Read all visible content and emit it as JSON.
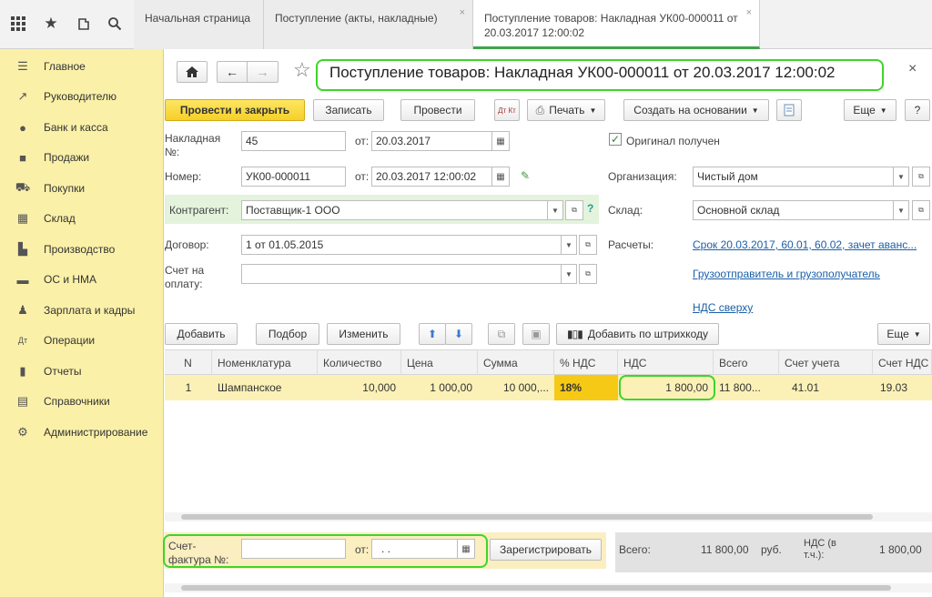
{
  "topbar": {
    "tabs": [
      {
        "label": "Начальная страница"
      },
      {
        "label": "Поступление (акты, накладные)"
      },
      {
        "label": "Поступление товаров: Накладная УК00-000011 от 20.03.2017 12:00:02"
      }
    ],
    "tab_close": "×"
  },
  "sidebar": {
    "items": [
      {
        "label": "Главное"
      },
      {
        "label": "Руководителю"
      },
      {
        "label": "Банк и касса"
      },
      {
        "label": "Продажи"
      },
      {
        "label": "Покупки"
      },
      {
        "label": "Склад"
      },
      {
        "label": "Производство"
      },
      {
        "label": "ОС и НМА"
      },
      {
        "label": "Зарплата и кадры"
      },
      {
        "label": "Операции"
      },
      {
        "label": "Отчеты"
      },
      {
        "label": "Справочники"
      },
      {
        "label": "Администрирование"
      }
    ]
  },
  "header": {
    "title": "Поступление товаров: Накладная УК00-000011 от 20.03.2017 12:00:02",
    "close": "×"
  },
  "toolbar": {
    "post_close": "Провести и закрыть",
    "save": "Записать",
    "post": "Провести",
    "dt_kt": "Дт Кт",
    "print": "Печать",
    "create_based": "Создать на основании",
    "more": "Еще",
    "help": "?"
  },
  "form": {
    "invoice_label": "Накладная №:",
    "invoice_no": "45",
    "from_label": "от:",
    "invoice_date": "20.03.2017",
    "original_received": "Оригинал получен",
    "number_label": "Номер:",
    "number": "УК00-000011",
    "number_date": "20.03.2017 12:00:02",
    "org_label": "Организация:",
    "org": "Чистый дом",
    "contractor_label": "Контрагент:",
    "contractor": "Поставщик-1 ООО",
    "warehouse_label": "Склад:",
    "warehouse": "Основной склад",
    "contract_label": "Договор:",
    "contract": "1 от 01.05.2015",
    "settlements_label": "Расчеты:",
    "settlements": "Срок 20.03.2017, 60.01, 60.02, зачет аванс...",
    "payment_account_label": "Счет на оплату:",
    "payment_account": "",
    "shipper_link": "Грузоотправитель и грузополучатель",
    "vat_link": "НДС сверху",
    "help_q": "?"
  },
  "table_toolbar": {
    "add": "Добавить",
    "pick": "Подбор",
    "edit": "Изменить",
    "barcode": "Добавить по штрихкоду",
    "more": "Еще"
  },
  "table": {
    "columns": [
      "N",
      "Номенклатура",
      "Количество",
      "Цена",
      "Сумма",
      "% НДС",
      "НДС",
      "Всего",
      "Счет учета",
      "Счет НДС"
    ],
    "rows": [
      [
        "1",
        "Шампанское",
        "10,000",
        "1 000,00",
        "10 000,...",
        "18%",
        "1 800,00",
        "11 800...",
        "41.01",
        "19.03"
      ]
    ]
  },
  "footer": {
    "invoice_label": "Счет-фактура №:",
    "invoice_no": "",
    "from_label": "от:",
    "invoice_date": ".  .",
    "register": "Зарегистрировать",
    "total_label": "Всего:",
    "total": "11 800,00",
    "currency": "руб.",
    "vat_label": "НДС (в т.ч.):",
    "vat": "1 800,00"
  },
  "colors": {
    "accent": "#3fd42a",
    "sidebar_bg": "#fbf0a8",
    "primary_button": "#f6cf29",
    "link": "#1a5fa8"
  }
}
